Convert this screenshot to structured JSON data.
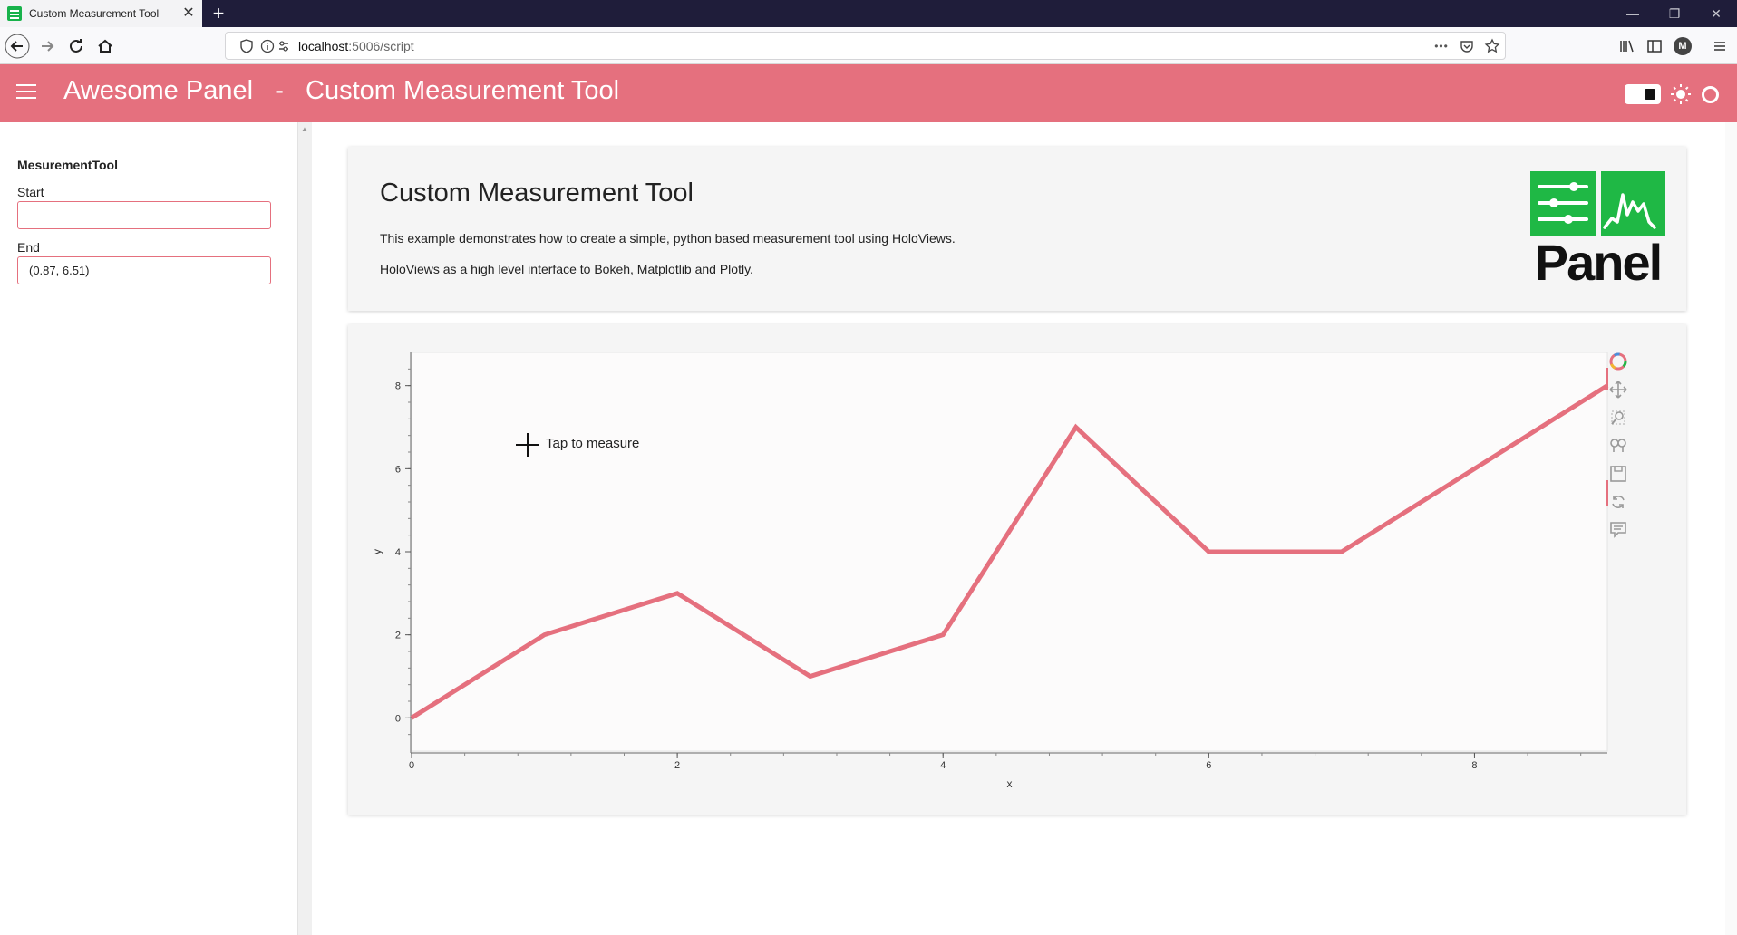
{
  "browser": {
    "tab_title": "Custom Measurement Tool",
    "tab_close": "✕",
    "new_tab": "+",
    "url_host": "localhost",
    "url_path": ":5006/script",
    "window_controls": [
      "—",
      "❐",
      "✕"
    ],
    "icons": [
      "back-arrow-icon",
      "forward-arrow-icon",
      "reload-icon",
      "home-icon",
      "shield-icon",
      "info-icon",
      "more-dots-icon",
      "pocket-icon",
      "star-icon",
      "library-icon",
      "sidebar-icon",
      "account-icon",
      "menu-icon"
    ],
    "more": "•••",
    "account_initial": "M"
  },
  "header": {
    "title": "Awesome Panel   -   Custom Measurement Tool",
    "accent_color": "#e5707e"
  },
  "sidebar": {
    "widget_title": "MesurementTool",
    "start_label": "Start",
    "start_value": "",
    "end_label": "End",
    "end_value": "(0.87, 6.51)"
  },
  "intro_card": {
    "title": "Custom Measurement Tool",
    "paragraph_1": "This example demonstrates how to create a simple, python based measurement tool using HoloViews.",
    "paragraph_2": "HoloViews as a high level interface to Bokeh, Matplotlib and Plotly.",
    "logo_text": "Panel",
    "logo_color": "#1fb845"
  },
  "plot": {
    "hover_text": "Tap to measure",
    "toolbar_icons": [
      "bokeh-logo-icon",
      "pan-icon",
      "zoom-icon",
      "box-zoom-icon",
      "save-icon",
      "reset-icon",
      "hover-icon"
    ]
  },
  "chart_data": {
    "type": "line",
    "x": [
      0,
      1,
      2,
      3,
      4,
      5,
      6,
      7,
      8,
      9
    ],
    "series": [
      {
        "values": [
          0,
          2,
          3,
          1,
          2,
          7,
          4,
          4,
          6,
          8
        ],
        "color": "#e5707e"
      }
    ],
    "xlabel": "x",
    "ylabel": "y",
    "xlim": [
      0,
      9
    ],
    "ylim": [
      -0.8,
      8.8
    ],
    "xticks": [
      0,
      2,
      4,
      6,
      8
    ],
    "yticks": [
      0,
      2,
      4,
      6,
      8
    ],
    "grid": false
  }
}
